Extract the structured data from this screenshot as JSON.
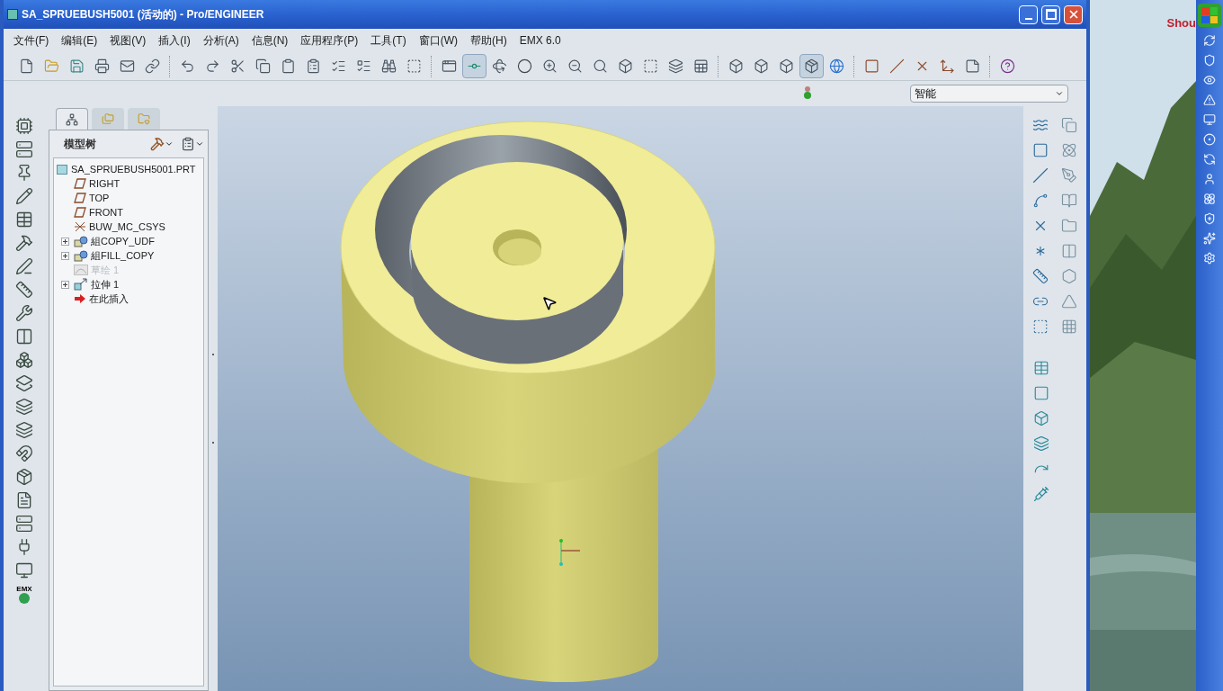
{
  "window": {
    "title": "SA_SPRUEBUSH5001 (活动的) - Pro/ENGINEER"
  },
  "menu": [
    "文件(F)",
    "编辑(E)",
    "视图(V)",
    "插入(I)",
    "分析(A)",
    "信息(N)",
    "应用程序(P)",
    "工具(T)",
    "窗口(W)",
    "帮助(H)",
    "EMX 6.0"
  ],
  "toolbar": [
    {
      "kind": "new",
      "pressed": false
    },
    {
      "kind": "open",
      "pressed": false
    },
    {
      "kind": "save",
      "pressed": false
    },
    {
      "kind": "print",
      "pressed": false
    },
    {
      "kind": "mail",
      "pressed": false
    },
    {
      "kind": "link",
      "pressed": false
    },
    {
      "kind": "separator"
    },
    {
      "kind": "undo",
      "pressed": false
    },
    {
      "kind": "redo",
      "pressed": false
    },
    {
      "kind": "cut",
      "pressed": false
    },
    {
      "kind": "copy",
      "pressed": false
    },
    {
      "kind": "paste",
      "pressed": false
    },
    {
      "kind": "paste-special",
      "pressed": false
    },
    {
      "kind": "regenerate",
      "pressed": false
    },
    {
      "kind": "regen-manager",
      "pressed": false
    },
    {
      "kind": "find",
      "pressed": false
    },
    {
      "kind": "select-box",
      "pressed": false
    },
    {
      "kind": "separator"
    },
    {
      "kind": "repaint",
      "pressed": false
    },
    {
      "kind": "spin-center",
      "pressed": true
    },
    {
      "kind": "orient",
      "pressed": false
    },
    {
      "kind": "appearance",
      "pressed": false
    },
    {
      "kind": "zoom-in",
      "pressed": false
    },
    {
      "kind": "zoom-out",
      "pressed": false
    },
    {
      "kind": "refit",
      "pressed": false
    },
    {
      "kind": "reorient",
      "pressed": false
    },
    {
      "kind": "saved-view",
      "pressed": false
    },
    {
      "kind": "layers",
      "pressed": false
    },
    {
      "kind": "view-manager",
      "pressed": false
    },
    {
      "kind": "separator"
    },
    {
      "kind": "wireframe",
      "pressed": false
    },
    {
      "kind": "hidden-line",
      "pressed": false
    },
    {
      "kind": "no-hidden",
      "pressed": false
    },
    {
      "kind": "shaded",
      "pressed": true
    },
    {
      "kind": "enhanced",
      "pressed": false
    },
    {
      "kind": "separator"
    },
    {
      "kind": "plane-display",
      "pressed": false
    },
    {
      "kind": "axis-display",
      "pressed": false
    },
    {
      "kind": "point-display",
      "pressed": false
    },
    {
      "kind": "csys-display",
      "pressed": false
    },
    {
      "kind": "annotation-display",
      "pressed": false
    },
    {
      "kind": "separator"
    },
    {
      "kind": "help",
      "pressed": false
    }
  ],
  "selection_filter": {
    "value": "智能"
  },
  "model_tree": {
    "tabs": [
      {
        "kind": "tree",
        "selected": true
      },
      {
        "kind": "folders",
        "selected": false
      },
      {
        "kind": "favorites",
        "selected": false
      }
    ],
    "title": "模型树",
    "root": {
      "label": "SA_SPRUEBUSH5001.PRT",
      "children": [
        {
          "kind": "plane",
          "label": "RIGHT",
          "disabled": false
        },
        {
          "kind": "plane",
          "label": "TOP",
          "disabled": false
        },
        {
          "kind": "plane",
          "label": "FRONT",
          "disabled": false
        },
        {
          "kind": "csys",
          "label": "BUW_MC_CSYS",
          "disabled": false
        },
        {
          "kind": "group",
          "label": "組COPY_UDF",
          "expanded": false,
          "disabled": false
        },
        {
          "kind": "group",
          "label": "組FILL_COPY",
          "expanded": false,
          "disabled": false
        },
        {
          "kind": "sketch",
          "label": "草绘 1",
          "disabled": true
        },
        {
          "kind": "extrude",
          "label": "拉伸 1",
          "expanded": false,
          "disabled": false
        },
        {
          "kind": "insert",
          "label": "在此插入",
          "disabled": false
        }
      ]
    }
  },
  "left_toolbar": {
    "emx_label": "EMX"
  },
  "desktop": {
    "text": "Shou"
  }
}
